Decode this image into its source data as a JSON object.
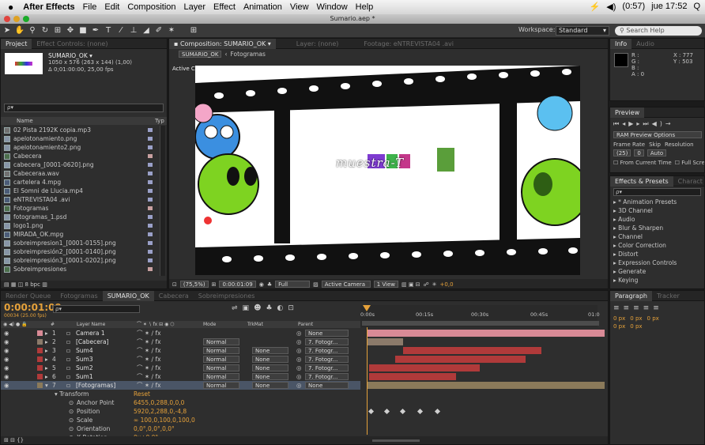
{
  "menubar": {
    "app_name": "After Effects",
    "items": [
      "File",
      "Edit",
      "Composition",
      "Layer",
      "Effect",
      "Animation",
      "View",
      "Window",
      "Help"
    ],
    "status": {
      "battery": "(0:57)",
      "clock": "jue 17:52"
    }
  },
  "window_title": "Sumario.aep *",
  "toolbar": {
    "workspace_label": "Workspace:",
    "workspace_value": "Standard",
    "search_placeholder": "Search Help"
  },
  "project_panel": {
    "tabs": [
      "Project",
      "Effect Controls: (none)"
    ],
    "item_name": "SUMARIO_OK ▾",
    "item_info1": "1050 x 576  (263 x 144) (1,00)",
    "item_info2": "Δ 0;01:00:00, 25,00 fps",
    "search_placeholder": "ρ▾",
    "col_name": "Name",
    "col_type": "Typ",
    "files": [
      {
        "name": "02 Pista 2192K copia.mp3",
        "kind": "aud",
        "color": "#9aa0c8"
      },
      {
        "name": "apelotonamiento.png",
        "kind": "img",
        "color": "#9aa0c8"
      },
      {
        "name": "apelotonamiento2.png",
        "kind": "img",
        "color": "#9aa0c8"
      },
      {
        "name": "Cabecera",
        "kind": "comp",
        "color": "#c8a0a0"
      },
      {
        "name": "cabecera_[0001-0620].png",
        "kind": "img",
        "color": "#9aa0c8"
      },
      {
        "name": "Cabeceraa.wav",
        "kind": "aud",
        "color": "#9aa0c8"
      },
      {
        "name": "cartelera 4.mpg",
        "kind": "vid",
        "color": "#9aa0c8"
      },
      {
        "name": "El Somni de Llucia.mp4",
        "kind": "vid",
        "color": "#9aa0c8"
      },
      {
        "name": "eNTREVISTA04 .avi",
        "kind": "vid",
        "color": "#9aa0c8"
      },
      {
        "name": "Fotogramas",
        "kind": "comp",
        "color": "#c8a0a0"
      },
      {
        "name": "fotogramas_1.psd",
        "kind": "img",
        "color": "#9aa0c8"
      },
      {
        "name": "logo1.png",
        "kind": "img",
        "color": "#9aa0c8"
      },
      {
        "name": "MIRADA_OK.mpg",
        "kind": "vid",
        "color": "#9aa0c8"
      },
      {
        "name": "sobreimpresion1_[0001-0155].png",
        "kind": "img",
        "color": "#9aa0c8"
      },
      {
        "name": "sobreimpresión2_[0001-0140].png",
        "kind": "img",
        "color": "#9aa0c8"
      },
      {
        "name": "sobreimpresión3_[0001-0202].png",
        "kind": "img",
        "color": "#9aa0c8"
      },
      {
        "name": "Sobreimpresiones",
        "kind": "comp",
        "color": "#c8a0a0"
      }
    ],
    "footer_bpc": "8 bpc"
  },
  "comp_panel": {
    "tabs": [
      "Composition: SUMARIO_OK",
      "Layer: (none)",
      "Footage: eNTREVISTA04 .avi"
    ],
    "subtabs": [
      "SUMARIO_OK",
      "Fotogramas"
    ],
    "active_camera": "Active Camera",
    "logo_text": "muestra-T",
    "footer": {
      "zoom": "(75,5%)",
      "timecode": "0:00:01:09",
      "resolution": "Full",
      "camera": "Active Camera",
      "view": "1 View",
      "offset": "+0,0"
    }
  },
  "right_panels": {
    "info_tabs": [
      "Info",
      "Audio"
    ],
    "info_rgb": [
      "R :",
      "G :",
      "B :",
      "A : 0"
    ],
    "info_xy": [
      "X : 777",
      "Y : 503"
    ],
    "preview_tab": "Preview",
    "ram_options": "RAM Preview Options",
    "frame_rate_label": "Frame Rate",
    "skip_label": "Skip",
    "resolution_label": "Resolution",
    "frame_rate_value": "(25)",
    "skip_value": "0",
    "resolution_value": "Auto",
    "from_current": "From Current Time",
    "full_screen": "Full Screen",
    "effects_tabs": [
      "Effects & Presets",
      "Charact"
    ],
    "effects_search": "ρ▾",
    "effects_list": [
      "* Animation Presets",
      "3D Channel",
      "Audio",
      "Blur & Sharpen",
      "Channel",
      "Color Correction",
      "Distort",
      "Expression Controls",
      "Generate",
      "Keying"
    ],
    "para_tabs": [
      "Paragraph",
      "Tracker"
    ],
    "para_values": [
      "0 px",
      "0 px",
      "0 px",
      "0 px",
      "0 px"
    ]
  },
  "timeline": {
    "tabs": [
      "Render Queue",
      "Fotogramas",
      "SUMARIO_OK",
      "Cabecera",
      "Sobreimpresiones"
    ],
    "timecode": "0:00:01:09",
    "frame_info": "00034 (25.00 fps)",
    "search": "ρ▾",
    "col_headers": {
      "num": "#",
      "layer_name": "Layer Name",
      "mode": "Mode",
      "trkmat": "TrkMat",
      "parent": "Parent"
    },
    "ruler_marks": [
      "0:00s",
      "00:15s",
      "00:30s",
      "00:45s",
      "01:0"
    ],
    "layers": [
      {
        "num": "1",
        "name": "Camera 1",
        "mode": "",
        "trk": "",
        "parent": "None",
        "bar_color": "#d98a96",
        "sel": false
      },
      {
        "num": "2",
        "name": "[Cabecera]",
        "mode": "Normal",
        "trk": "",
        "parent": "7. Fotogr...",
        "bar_color": "#8b7a6a",
        "sel": false
      },
      {
        "num": "3",
        "name": "Sum4",
        "mode": "Normal",
        "trk": "None",
        "parent": "7. Fotogr...",
        "bar_color": "#b03a3a",
        "sel": false
      },
      {
        "num": "4",
        "name": "Sum3",
        "mode": "Normal",
        "trk": "None",
        "parent": "7. Fotogr...",
        "bar_color": "#b03a3a",
        "sel": false
      },
      {
        "num": "5",
        "name": "Sum2",
        "mode": "Normal",
        "trk": "None",
        "parent": "7. Fotogr...",
        "bar_color": "#b03a3a",
        "sel": false
      },
      {
        "num": "6",
        "name": "Sum1",
        "mode": "Normal",
        "trk": "None",
        "parent": "7. Fotogr...",
        "bar_color": "#b03a3a",
        "sel": false
      },
      {
        "num": "7",
        "name": "[Fotogramas]",
        "mode": "Normal",
        "trk": "None",
        "parent": "None",
        "bar_color": "#8b7a5a",
        "sel": true
      }
    ],
    "transform": {
      "label": "Transform",
      "reset": "Reset",
      "props": [
        {
          "name": "Anchor Point",
          "value": "6455,0,288,0,0,0"
        },
        {
          "name": "Position",
          "value": "5920,2,288,0,-4,8"
        },
        {
          "name": "Scale",
          "value": "∞ 100,0,100,0,100,0"
        },
        {
          "name": "Orientation",
          "value": "0,0°,0,0°,0,0°"
        },
        {
          "name": "X Rotation",
          "value": "0x+0,0°"
        }
      ]
    }
  }
}
